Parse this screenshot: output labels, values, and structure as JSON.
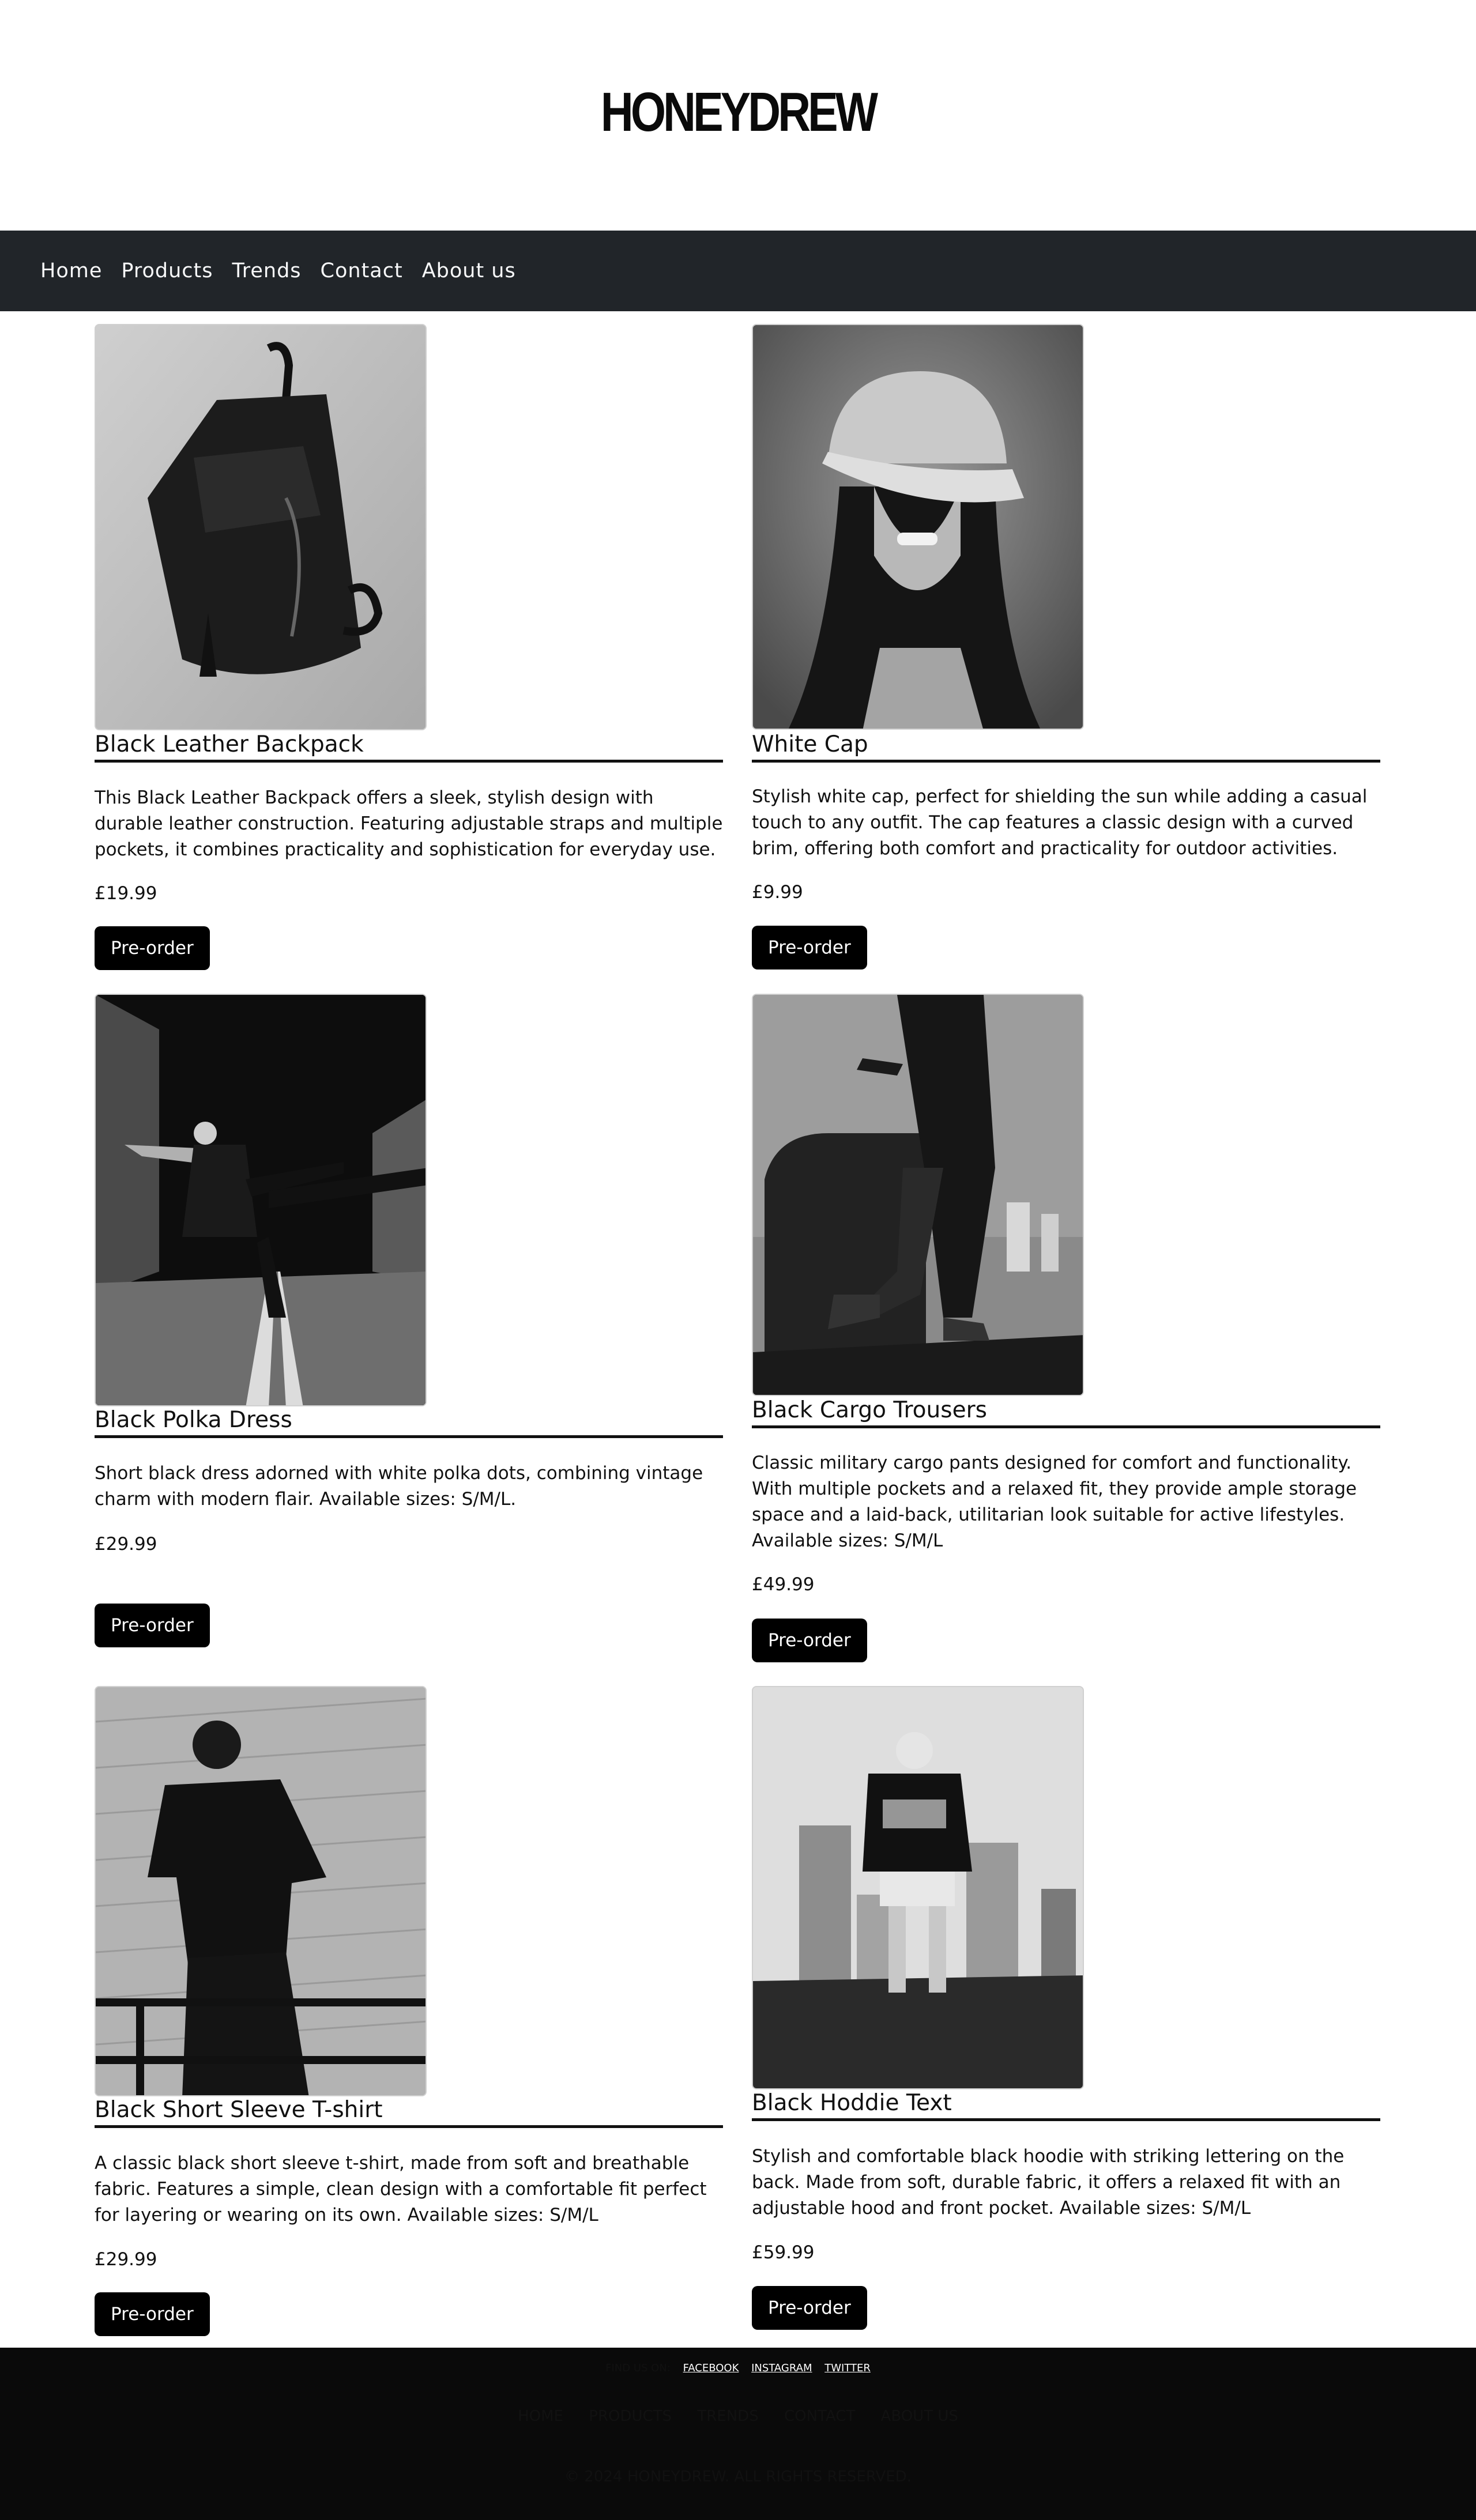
{
  "brand": {
    "name": "HONEYDREW"
  },
  "nav": {
    "items": [
      "Home",
      "Products",
      "Trends",
      "Contact",
      "About us"
    ]
  },
  "products": [
    {
      "name": "Black Leather Backpack",
      "description": "This Black Leather Backpack offers a sleek, stylish design with durable leather construction. Featuring adjustable straps and multiple pockets, it combines practicality and sophistication for everyday use.",
      "price": "£19.99",
      "button": "Pre-order"
    },
    {
      "name": "White Cap",
      "description": "Stylish white cap, perfect for shielding the sun while adding a casual touch to any outfit. The cap features a classic design with a curved brim, offering both comfort and practicality for outdoor activities.",
      "price": "£9.99",
      "button": "Pre-order"
    },
    {
      "name": "Black Polka Dress",
      "description": "Short black dress adorned with white polka dots, combining vintage charm with modern flair. Available sizes: S/M/L.",
      "price": "£29.99",
      "button": "Pre-order"
    },
    {
      "name": "Black Cargo Trousers",
      "description": "Classic military cargo pants designed for comfort and functionality. With multiple pockets and a relaxed fit, they provide ample storage space and a laid-back, utilitarian look suitable for active lifestyles. Available sizes: S/M/L",
      "price": "£49.99",
      "button": "Pre-order"
    },
    {
      "name": "Black Short Sleeve T-shirt",
      "description": "A classic black short sleeve t-shirt, made from soft and breathable fabric. Features a simple, clean design with a comfortable fit perfect for layering or wearing on its own. Available sizes: S/M/L",
      "price": "£29.99",
      "button": "Pre-order"
    },
    {
      "name": "Black Hoddie Text",
      "description": "Stylish and comfortable black hoodie with striking lettering on the back. Made from soft, durable fabric, it offers a relaxed fit with an adjustable hood and front pocket. Available sizes: S/M/L",
      "price": "£59.99",
      "button": "Pre-order"
    }
  ],
  "footer": {
    "find_us": "FIND US ON:",
    "social": [
      "FACEBOOK",
      "INSTAGRAM",
      "TWITTER"
    ],
    "nav": [
      "HOME",
      "PRODUCTS",
      "TRENDS",
      "CONTACT",
      "ABOUT US"
    ],
    "copyright": "© 2024 HONEYDREW. ALL RIGHTS RESERVED."
  }
}
